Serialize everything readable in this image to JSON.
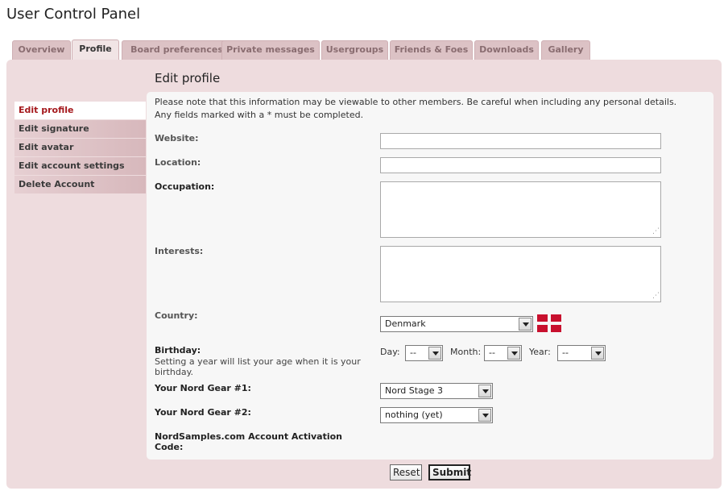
{
  "page_title": "User Control Panel",
  "tabs": [
    {
      "label": "Overview",
      "active": false
    },
    {
      "label": "Profile",
      "active": true
    },
    {
      "label": "Board preferences",
      "active": false
    },
    {
      "label": "Private messages",
      "active": false
    },
    {
      "label": "Usergroups",
      "active": false
    },
    {
      "label": "Friends & Foes",
      "active": false
    },
    {
      "label": "Downloads",
      "active": false
    },
    {
      "label": "Gallery",
      "active": false
    }
  ],
  "sidebar": {
    "items": [
      {
        "label": "Edit profile",
        "active": true
      },
      {
        "label": "Edit signature",
        "active": false
      },
      {
        "label": "Edit avatar",
        "active": false
      },
      {
        "label": "Edit account settings",
        "active": false
      },
      {
        "label": "Delete Account",
        "active": false
      }
    ]
  },
  "section_title": "Edit profile",
  "notice": {
    "line1": "Please note that this information may be viewable to other members. Be careful when including any personal details.",
    "line2": "Any fields marked with a * must be completed."
  },
  "fields": {
    "website": {
      "label": "Website:",
      "value": ""
    },
    "location": {
      "label": "Location:",
      "value": ""
    },
    "occupation": {
      "label": "Occupation:",
      "value": ""
    },
    "interests": {
      "label": "Interests:",
      "value": ""
    },
    "country": {
      "label": "Country:",
      "selected": "Denmark",
      "flag_icon": "denmark-flag-icon"
    },
    "birthday": {
      "label": "Birthday:",
      "help": "Setting a year will list your age when it is your birthday.",
      "day_label": "Day:",
      "day_value": "--",
      "month_label": "Month:",
      "month_value": "--",
      "year_label": "Year:",
      "year_value": "--"
    },
    "nord_gear_1": {
      "label": "Your Nord Gear #1:",
      "selected": "Nord Stage 3"
    },
    "nord_gear_2": {
      "label": "Your Nord Gear #2:",
      "selected": "nothing (yet)"
    },
    "activation_code": {
      "label": "NordSamples.com Account Activation Code:"
    }
  },
  "buttons": {
    "reset": "Reset",
    "submit": "Submit"
  },
  "colors": {
    "panel_bg": "#eedcde",
    "active_nav": "#a5191d",
    "tab_bg": "#dcc2c5"
  }
}
